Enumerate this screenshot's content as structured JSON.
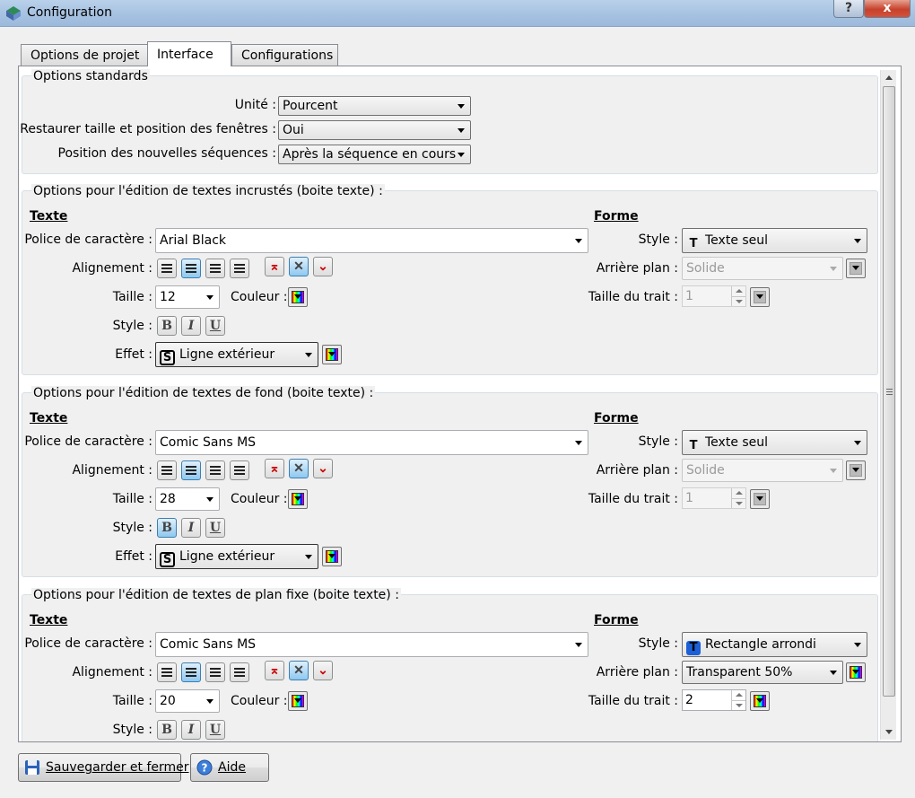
{
  "window": {
    "title": "Configuration",
    "help_label": "?",
    "close_label": "x"
  },
  "tabs": [
    {
      "label": "Options de projet"
    },
    {
      "label": "Interface"
    },
    {
      "label": "Configurations"
    }
  ],
  "standard": {
    "title": "Options standards",
    "unit_label": "Unité :",
    "unit_value": "Pourcent",
    "restore_label": "Restaurer taille et position des fenêtres :",
    "restore_value": "Oui",
    "position_label": "Position des nouvelles séquences :",
    "position_value": "Après la séquence en cours"
  },
  "labels": {
    "texte": "Texte",
    "forme": "Forme",
    "font": "Police de caractère :",
    "align": "Alignement :",
    "size": "Taille :",
    "color": "Couleur :",
    "style": "Style :",
    "effect": "Effet :",
    "shape_style": "Style :",
    "background": "Arrière plan :",
    "stroke": "Taille du trait :",
    "bold": "B",
    "italic": "I",
    "underline": "U"
  },
  "groups": [
    {
      "title": "Options pour l'édition de textes incrustés (boite texte) :",
      "font": "Arial Black",
      "size": "12",
      "effect": "Ligne extérieur",
      "bold_on": false,
      "shape_style": "Texte seul",
      "background": "Solide",
      "stroke": "1",
      "forme_enabled": false
    },
    {
      "title": "Options pour l'édition de textes de fond (boite texte) :",
      "font": "Comic Sans MS",
      "size": "28",
      "effect": "Ligne extérieur",
      "bold_on": true,
      "shape_style": "Texte seul",
      "background": "Solide",
      "stroke": "1",
      "forme_enabled": false
    },
    {
      "title": "Options pour l'édition de textes de plan fixe (boite texte) :",
      "font": "Comic Sans MS",
      "size": "20",
      "bold_on": false,
      "shape_style": "Rectangle arrondi",
      "background": "Transparent 50%",
      "stroke": "2",
      "forme_enabled": true
    }
  ],
  "footer": {
    "save_label": "Sauvegarder et fermer",
    "help_label": "Aide"
  },
  "icons": [
    "app-icon",
    "floppy-icon",
    "help-icon",
    "outline-effect-icon",
    "text-only-icon",
    "rounded-rect-icon"
  ]
}
